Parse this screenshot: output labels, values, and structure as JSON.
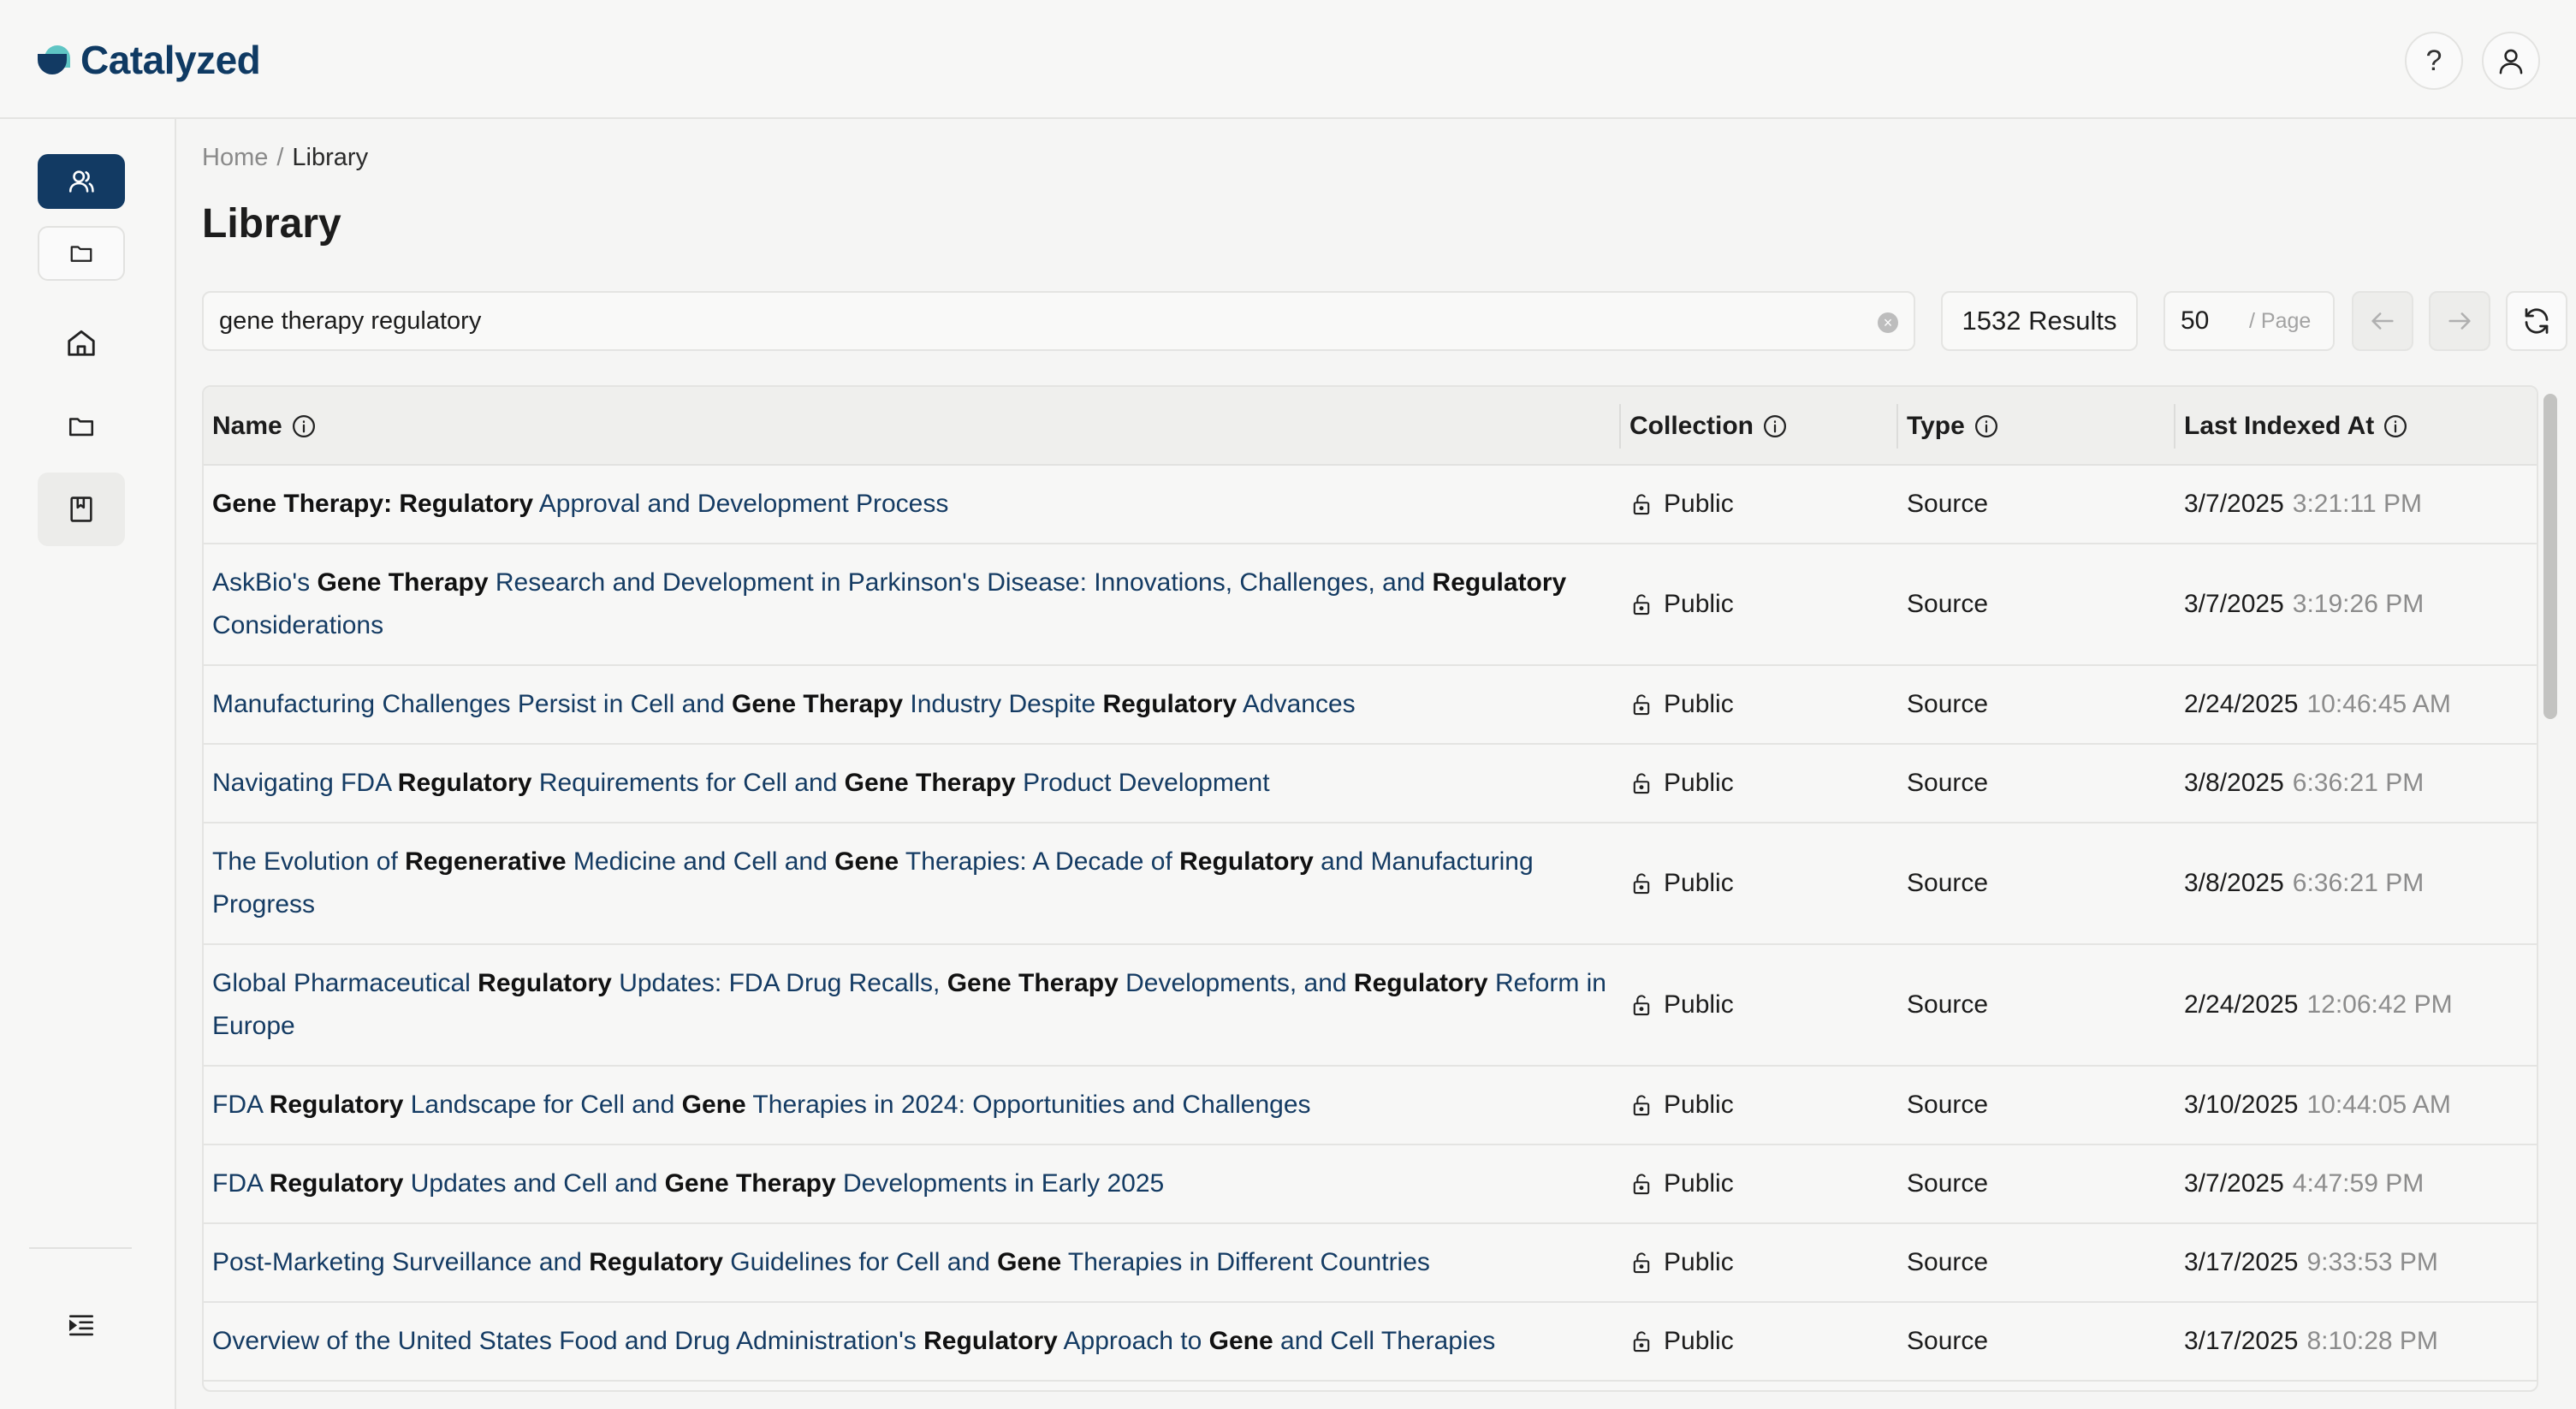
{
  "app": {
    "name": "Catalyzed"
  },
  "header": {
    "help_label": "?"
  },
  "breadcrumb": {
    "home": "Home",
    "separator": "/",
    "current": "Library"
  },
  "page": {
    "title": "Library"
  },
  "search": {
    "value": "gene therapy regulatory",
    "clear_glyph": "×"
  },
  "results": {
    "label": "1532 Results"
  },
  "pagination": {
    "per_page": "50",
    "per_page_unit": "/ Page"
  },
  "sidebar": {
    "items": [
      {
        "icon": "users-icon",
        "active": true
      },
      {
        "icon": "folder-icon"
      },
      {
        "icon": "home-icon"
      },
      {
        "icon": "folder-icon"
      },
      {
        "icon": "bookmark-icon",
        "selected": true
      }
    ],
    "collapse_icon": "indent-icon"
  },
  "table": {
    "columns": [
      "Name",
      "Collection",
      "Type",
      "Last Indexed At"
    ],
    "rows": [
      {
        "name": "<b>Gene Therapy: Regulatory</b> Approval and Development Process",
        "collection": "Public",
        "type": "Source",
        "date": "3/7/2025",
        "time": "3:21:11 PM"
      },
      {
        "name": "AskBio's <b>Gene Therapy</b> Research and Development in Parkinson's Disease: Innovations, Challenges, and <b>Regulatory</b> Considerations",
        "collection": "Public",
        "type": "Source",
        "date": "3/7/2025",
        "time": "3:19:26 PM"
      },
      {
        "name": "Manufacturing Challenges Persist in Cell and <b>Gene Therapy</b> Industry Despite <b>Regulatory</b> Advances",
        "collection": "Public",
        "type": "Source",
        "date": "2/24/2025",
        "time": "10:46:45 AM"
      },
      {
        "name": "Navigating FDA <b>Regulatory</b> Requirements for Cell and <b>Gene Therapy</b> Product Development",
        "collection": "Public",
        "type": "Source",
        "date": "3/8/2025",
        "time": "6:36:21 PM"
      },
      {
        "name": "The Evolution of <b>Regenerative</b> Medicine and Cell and <b>Gene</b> Therapies: A Decade of <b>Regulatory</b> and Manufacturing Progress",
        "collection": "Public",
        "type": "Source",
        "date": "3/8/2025",
        "time": "6:36:21 PM"
      },
      {
        "name": "Global Pharmaceutical <b>Regulatory</b> Updates: FDA Drug Recalls, <b>Gene Therapy</b> Developments, and <b>Regulatory</b> Reform in Europe",
        "collection": "Public",
        "type": "Source",
        "date": "2/24/2025",
        "time": "12:06:42 PM"
      },
      {
        "name": "FDA <b>Regulatory</b> Landscape for Cell and <b>Gene</b> Therapies in 2024: Opportunities and Challenges",
        "collection": "Public",
        "type": "Source",
        "date": "3/10/2025",
        "time": "10:44:05 AM"
      },
      {
        "name": "FDA <b>Regulatory</b> Updates and Cell and <b>Gene Therapy</b> Developments in Early 2025",
        "collection": "Public",
        "type": "Source",
        "date": "3/7/2025",
        "time": "4:47:59 PM"
      },
      {
        "name": "Post-Marketing Surveillance and <b>Regulatory</b> Guidelines for Cell and <b>Gene</b> Therapies in Different Countries",
        "collection": "Public",
        "type": "Source",
        "date": "3/17/2025",
        "time": "9:33:53 PM"
      },
      {
        "name": "Overview of the United States Food and Drug Administration's <b>Regulatory</b> Approach to <b>Gene</b> and Cell Therapies",
        "collection": "Public",
        "type": "Source",
        "date": "3/17/2025",
        "time": "8:10:28 PM"
      }
    ]
  },
  "colors": {
    "primary": "#123a63",
    "accent": "#5fc5c4",
    "link": "#143b63"
  }
}
